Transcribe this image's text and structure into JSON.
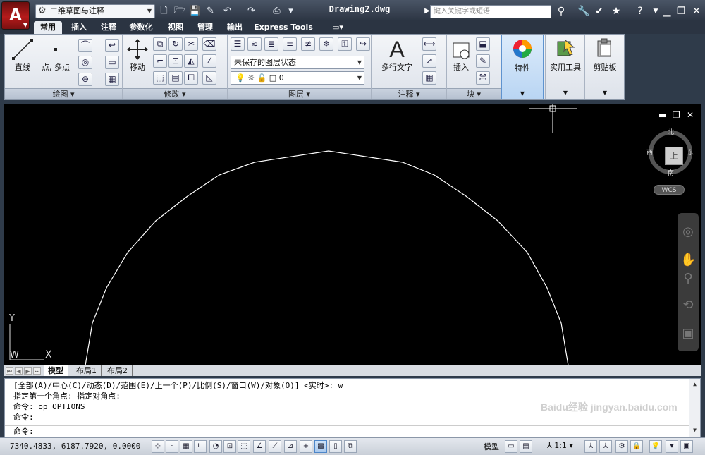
{
  "titlebar": {
    "app_button": "A",
    "workspace": "二维草图与注释",
    "document_title": "Drawing2.dwg",
    "search_placeholder": "键入关键字或短语"
  },
  "tabs": [
    "常用",
    "插入",
    "注释",
    "参数化",
    "视图",
    "管理",
    "输出",
    "Express Tools"
  ],
  "ribbon": {
    "draw": {
      "title": "绘图",
      "line_label": "直线",
      "polyline_label": "点, 多点"
    },
    "modify": {
      "title": "修改",
      "move_label": "移动"
    },
    "layers": {
      "title": "图层",
      "layer_state": "未保存的图层状态",
      "current_layer": "0"
    },
    "annotation": {
      "title": "注释",
      "mtext_label": "多行文字"
    },
    "block": {
      "title": "块",
      "insert_label": "插入"
    },
    "properties_label": "特性",
    "utilities_label": "实用工具",
    "clipboard_label": "剪贴板"
  },
  "viewcube": {
    "north": "北",
    "south": "南",
    "east": "东",
    "west": "西",
    "face": "上",
    "wcs": "WCS"
  },
  "layout_tabs": [
    "模型",
    "布局1",
    "布局2"
  ],
  "command": {
    "line1": "[全部(A)/中心(C)/动态(D)/范围(E)/上一个(P)/比例(S)/窗口(W)/对象(O)] <实时>: w",
    "line2": "指定第一个角点: 指定对角点:",
    "line3": "命令: op OPTIONS",
    "line4": "命令:",
    "prompt": "命令:"
  },
  "status": {
    "coords": "7340.4833, 6187.7920, 0.0000",
    "model_label": "模型",
    "scale": "1:1"
  },
  "ucs": {
    "y": "Y",
    "x": "X",
    "w": "W"
  },
  "watermark": "Baidu经验 jingyan.baidu.com",
  "colors": {
    "background": "#000000",
    "curve": "#ffffff",
    "ribbon": "#e9edf3"
  }
}
